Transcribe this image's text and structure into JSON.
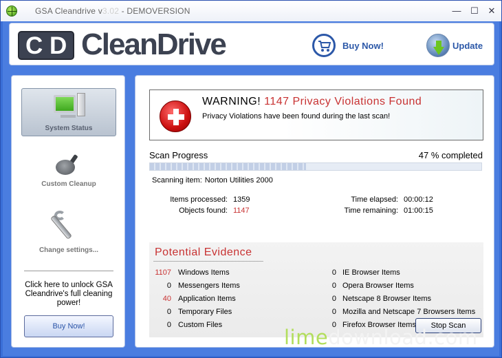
{
  "window": {
    "title": "GSA Cleandrive v",
    "title_version": "3.02",
    "title_suffix": " - DEMOVERSION",
    "minimize": "—",
    "maximize": "☐",
    "close": "✕"
  },
  "header": {
    "logo_c": "C",
    "logo_d": "D",
    "logo_name": "CleanDrive",
    "buy_now": "Buy Now!",
    "update": "Update"
  },
  "sidebar": {
    "items": [
      {
        "label": "System Status",
        "icon": "computer-icon",
        "active": true
      },
      {
        "label": "Custom Cleanup",
        "icon": "frying-pan-icon",
        "active": false
      },
      {
        "label": "Change settings...",
        "icon": "wrench-icon",
        "active": false
      }
    ],
    "unlock_text": "Click here to unlock GSA Cleandrive's full cleaning power!",
    "buy_button": "Buy Now!"
  },
  "warning": {
    "prefix": "WARNING! ",
    "count": "1147",
    "suffix": " Privacy Violations Found",
    "subtitle": "Privacy Violations have been found during the last scan!"
  },
  "scan": {
    "progress_label": "Scan Progress",
    "progress_text": "47 % completed",
    "progress_fraction": 0.47,
    "item_label": "Scanning item:",
    "item_value": "Norton Utilities 2000",
    "items_processed_label": "Items processed:",
    "items_processed": "1359",
    "objects_found_label": "Objects found:",
    "objects_found": "1147",
    "time_elapsed_label": "Time elapsed:",
    "time_elapsed": "00:00:12",
    "time_remaining_label": "Time remaining:",
    "time_remaining": "01:00:15"
  },
  "evidence": {
    "title": "Potential Evidence",
    "left": [
      {
        "count": "1107",
        "name": "Windows Items",
        "highlight": true
      },
      {
        "count": "0",
        "name": "Messengers Items",
        "highlight": false
      },
      {
        "count": "40",
        "name": "Application Items",
        "highlight": true
      },
      {
        "count": "0",
        "name": "Temporary Files",
        "highlight": false
      },
      {
        "count": "0",
        "name": "Custom Files",
        "highlight": false
      }
    ],
    "right": [
      {
        "count": "0",
        "name": "IE Browser Items"
      },
      {
        "count": "0",
        "name": "Opera Browser Items"
      },
      {
        "count": "0",
        "name": "Netscape 8 Browser Items"
      },
      {
        "count": "0",
        "name": "Mozilla and Netscape 7 Browsers Items"
      },
      {
        "count": "0",
        "name": "Firefox Browser Items"
      }
    ]
  },
  "stop_button": "Stop Scan",
  "watermark": {
    "lime": "lime",
    "rest": "download.com"
  },
  "colors": {
    "accent": "#2c58a8",
    "alert": "#c83232",
    "frame": "#4a7de0"
  }
}
